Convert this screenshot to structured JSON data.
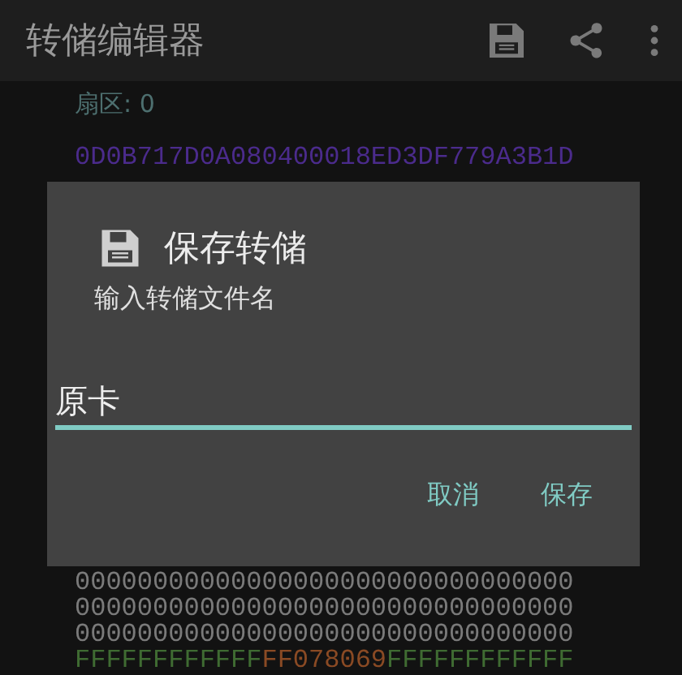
{
  "app_bar": {
    "title": "转储编辑器"
  },
  "sector_label": "扇区: 0",
  "dialog": {
    "title": "保存转储",
    "message": "输入转储文件名",
    "input": {
      "value": "原卡"
    },
    "buttons": [
      "取消",
      "保存"
    ]
  },
  "hex_rows_top": [
    {
      "segments": [
        {
          "text": "0D0B717D0A080400018ED3DF779A3B1D",
          "color": "#4b2b8c"
        }
      ]
    }
  ],
  "hex_rows_bottom": [
    {
      "segments": [
        {
          "text": "00000000000000000000000000000000",
          "color": "#7a7a7a"
        }
      ]
    },
    {
      "segments": [
        {
          "text": "00000000000000000000000000000000",
          "color": "#7a7a7a"
        }
      ]
    },
    {
      "segments": [
        {
          "text": "00000000000000000000000000000000",
          "color": "#7a7a7a"
        }
      ]
    },
    {
      "segments": [
        {
          "text": "FFFFFFFFFFFF",
          "color": "#3f6b32"
        },
        {
          "text": "FF078069",
          "color": "#8a4a24"
        },
        {
          "text": "FFFFFFFFFFFF",
          "color": "#3f6b32"
        }
      ]
    }
  ]
}
